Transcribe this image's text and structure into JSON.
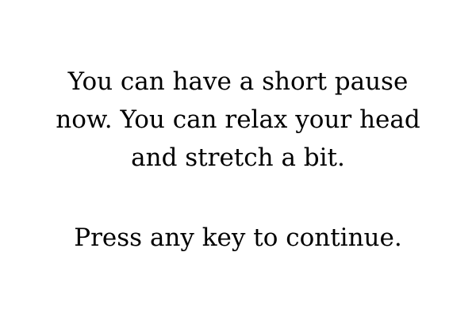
{
  "pause_message": {
    "lines": [
      "You can have a short pause",
      "now. You can relax your head",
      "and stretch a bit."
    ]
  },
  "continue_prompt": "Press any key to continue."
}
